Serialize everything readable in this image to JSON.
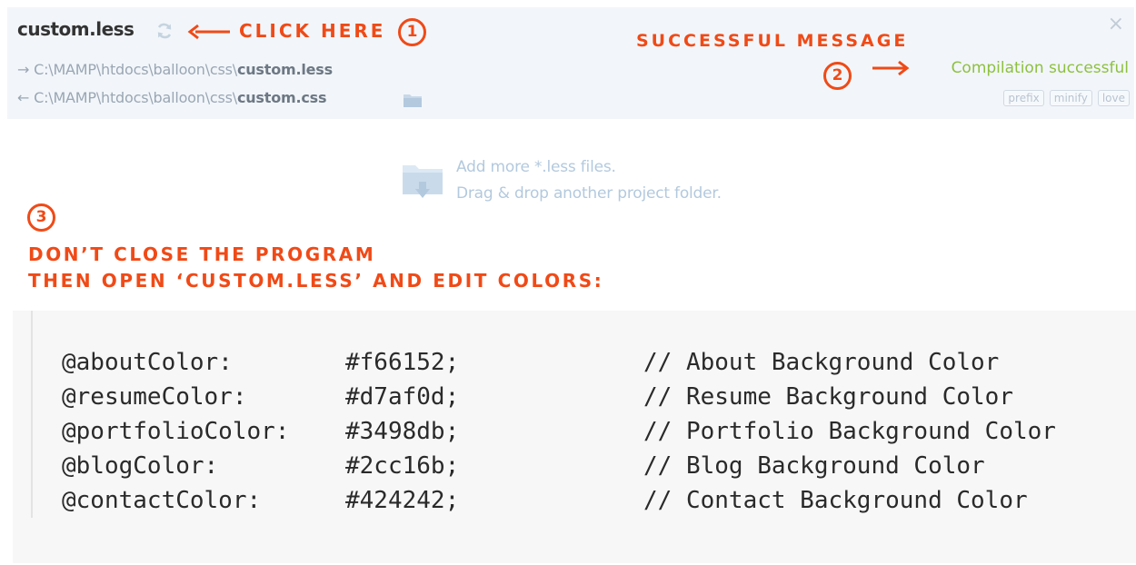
{
  "file_panel": {
    "file_name": "custom.less",
    "input_prefix": "→ C:\\MAMP\\htdocs\\balloon\\css\\",
    "input_file": "custom.less",
    "output_prefix": "← C:\\MAMP\\htdocs\\balloon\\css\\",
    "output_file": "custom.css",
    "close_symbol": "×",
    "status": "Compilation successful",
    "options": [
      "prefix",
      "minify",
      "love"
    ],
    "icons": {
      "refresh": "refresh-icon",
      "folder": "folder-icon",
      "close": "close-icon"
    }
  },
  "annotations": {
    "click_here": "CLICK HERE",
    "success_message": "SUCCESSFUL MESSAGE",
    "step3_line1": "DON’T CLOSE THE PROGRAM",
    "step3_line2": "THEN OPEN ‘CUSTOM.LESS’ AND EDIT COLORS:",
    "steps": [
      "1",
      "2",
      "3"
    ],
    "color": "#f04a17"
  },
  "drop_zone": {
    "line1": "Add more *.less files.",
    "line2": "Drag & drop another project folder.",
    "icon": "folder-drop-icon"
  },
  "code": {
    "lines": [
      {
        "var": "@aboutColor:",
        "val": "#f66152;",
        "comment": "// About Background Color"
      },
      {
        "var": "@resumeColor:",
        "val": "#d7af0d;",
        "comment": "// Resume Background Color"
      },
      {
        "var": "@portfolioColor:",
        "val": "#3498db;",
        "comment": "// Portfolio Background Color"
      },
      {
        "var": "@blogColor:",
        "val": "#2cc16b;",
        "comment": "// Blog Background Color"
      },
      {
        "var": "@contactColor:",
        "val": "#424242;",
        "comment": "// Contact Background Color"
      }
    ]
  }
}
